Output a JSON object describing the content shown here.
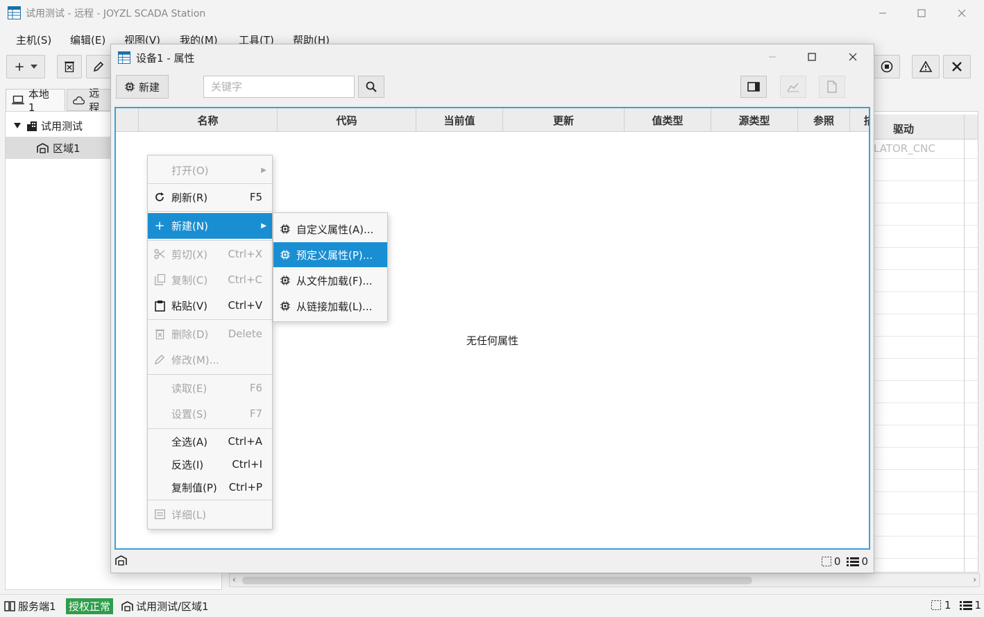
{
  "window": {
    "title": "试用测试 - 远程 - JOYZL SCADA Station",
    "app_icon": "table-icon"
  },
  "menubar": [
    "主机(S)",
    "编辑(E)",
    "视图(V)",
    "我的(M)",
    "工具(T)",
    "帮助(H)"
  ],
  "toolbar": {
    "add_label": "+"
  },
  "tabs": {
    "local": "本地 1",
    "remote": "远程"
  },
  "tree": {
    "root": "试用测试",
    "child": "区域1"
  },
  "background_grid": {
    "header": "驱动",
    "faded_value": "LATOR_CNC"
  },
  "dialog": {
    "title": "设备1 - 属性",
    "new_button": "新建",
    "search_placeholder": "关键字",
    "columns": [
      "名称",
      "代码",
      "当前值",
      "更新",
      "值类型",
      "源类型",
      "参照",
      "描"
    ],
    "empty_message": "无任何属性",
    "selected_count": "0",
    "total_count": "0"
  },
  "context_menu": {
    "items": [
      {
        "label": "打开(O)",
        "shortcut": "",
        "disabled": true,
        "submenu": true
      },
      {
        "label": "刷新(R)",
        "shortcut": "F5",
        "disabled": false
      },
      {
        "label": "新建(N)",
        "shortcut": "",
        "disabled": false,
        "submenu": true,
        "highlighted": true
      },
      {
        "label": "剪切(X)",
        "shortcut": "Ctrl+X",
        "disabled": true
      },
      {
        "label": "复制(C)",
        "shortcut": "Ctrl+C",
        "disabled": true
      },
      {
        "label": "粘贴(V)",
        "shortcut": "Ctrl+V",
        "disabled": false
      },
      {
        "label": "删除(D)",
        "shortcut": "Delete",
        "disabled": true
      },
      {
        "label": "修改(M)...",
        "shortcut": "",
        "disabled": true
      },
      {
        "label": "读取(E)",
        "shortcut": "F6",
        "disabled": true
      },
      {
        "label": "设置(S)",
        "shortcut": "F7",
        "disabled": true
      },
      {
        "label": "全选(A)",
        "shortcut": "Ctrl+A",
        "disabled": false
      },
      {
        "label": "反选(I)",
        "shortcut": "Ctrl+I",
        "disabled": false
      },
      {
        "label": "复制值(P)",
        "shortcut": "Ctrl+P",
        "disabled": false
      },
      {
        "label": "详细(L)",
        "shortcut": "",
        "disabled": true
      }
    ]
  },
  "submenu": {
    "items": [
      {
        "label": "自定义属性(A)...",
        "highlighted": false
      },
      {
        "label": "预定义属性(P)...",
        "highlighted": true
      },
      {
        "label": "从文件加载(F)...",
        "highlighted": false
      },
      {
        "label": "从链接加载(L)...",
        "highlighted": false
      }
    ]
  },
  "statusbar": {
    "server": "服务端1",
    "license": "授权正常",
    "path": "试用测试/区域1",
    "selected": "1",
    "total": "1"
  },
  "colors": {
    "accent": "#1a8ed2",
    "table_border": "#3aa0d8",
    "license_ok": "#2e9e4a"
  }
}
